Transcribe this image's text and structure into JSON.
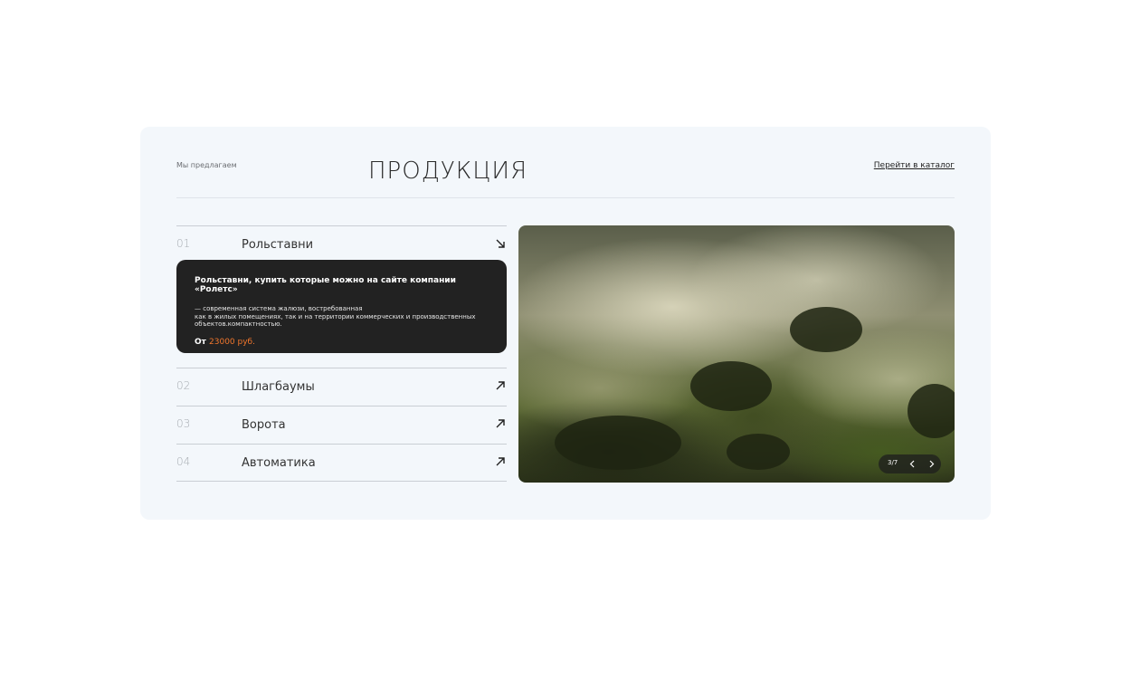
{
  "section": {
    "kicker": "Мы предлагаем",
    "title": "ПРОДУКЦИЯ",
    "catalog_link": "Перейти в каталог"
  },
  "products": [
    {
      "num": "01",
      "name": "Рольставни",
      "expanded": true,
      "heading": "Рольставни, купить которые можно на сайте компании «Ролетс»",
      "description": "— современная система жалюзи, востребованная\nкак в жилых помещениях, так и на территории коммерческих и производственных\nобъектов.компактностью.",
      "price_prefix": "От",
      "price": "23000 руб."
    },
    {
      "num": "02",
      "name": "Шлагбаумы"
    },
    {
      "num": "03",
      "name": "Ворота"
    },
    {
      "num": "04",
      "name": "Автоматика"
    }
  ],
  "gallery": {
    "counter": "3/7",
    "icons": {
      "prev": "chevron-left-icon",
      "next": "chevron-right-icon"
    }
  },
  "colors": {
    "accent": "#f0762c",
    "panel": "#222222",
    "card_bg": "#f3f7fb"
  }
}
